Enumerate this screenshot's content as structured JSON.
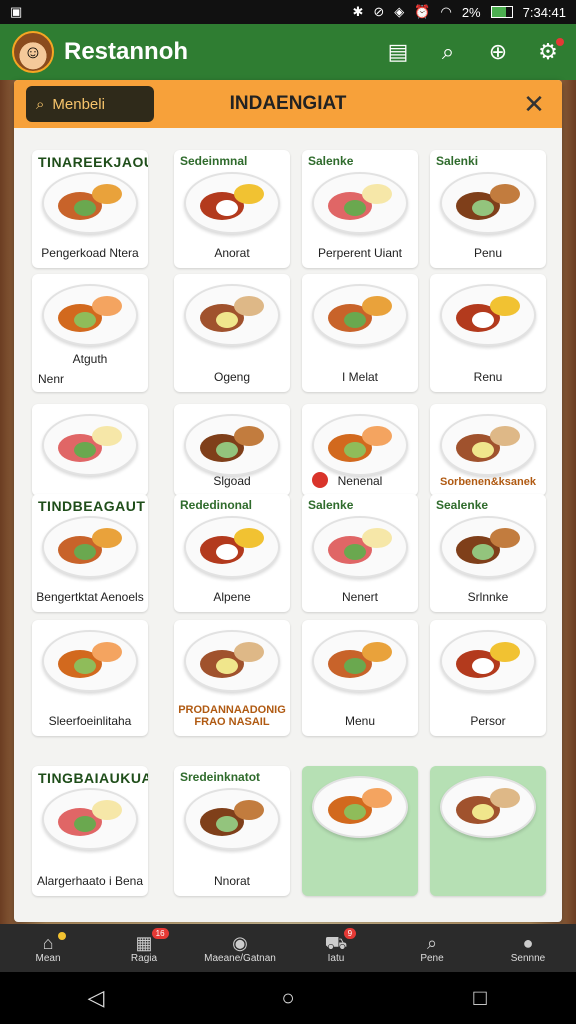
{
  "status": {
    "left_icon": "notification-icon",
    "battery": "2%",
    "time": "7:34:41"
  },
  "app": {
    "title": "Restannoh"
  },
  "panel": {
    "search_label": "Menbeli",
    "title": "INDAENGIAT"
  },
  "cells": [
    {
      "head": "TINAREEKJAOUT",
      "head_big": true,
      "label": "Pengerkoad Ntera",
      "extra": ""
    },
    {
      "head": "Sedeinmnal",
      "label": "Anorat"
    },
    {
      "head": "Salenke",
      "label": "Perperent Uiant"
    },
    {
      "head": "Salenki",
      "label": "Penu"
    },
    {
      "head": "",
      "label": "Atguth",
      "extra": "Nenr"
    },
    {
      "head": "",
      "label": "Ogeng"
    },
    {
      "head": "",
      "label": "I Melat"
    },
    {
      "head": "",
      "label": "Renu"
    },
    {
      "head": "",
      "label": ""
    },
    {
      "head": "",
      "label": "Slgoad"
    },
    {
      "head": "",
      "label": "Nenenal"
    },
    {
      "head": "",
      "label": "Sorbenen&ksanek"
    },
    {
      "head": "TINDBEAGAUT",
      "head_big": true,
      "label": "Bengertktat Aenoels"
    },
    {
      "head": "Rededinonal",
      "label": "Alpene"
    },
    {
      "head": "Salenke",
      "label": "Nenert"
    },
    {
      "head": "Sealenke",
      "label": "Srlnnke"
    },
    {
      "head": "",
      "label": "Sleerfoeinlitaha"
    },
    {
      "head": "",
      "label": "PRODANNAADONIG FRAO NASAIL"
    },
    {
      "head": "",
      "label": "Menu"
    },
    {
      "head": "",
      "label": "Persor"
    },
    {
      "head": "TINGBAIAUKUA",
      "head_big": true,
      "label": "Alargerhaato i Bena"
    },
    {
      "head": "Sredeinknatot",
      "label": "Nnorat"
    },
    {
      "head": "",
      "label": ""
    },
    {
      "head": "",
      "label": ""
    }
  ],
  "bottom_nav": [
    {
      "label": "Mean",
      "icon": "home-icon"
    },
    {
      "label": "Ragia",
      "icon": "store-icon",
      "badge": "16"
    },
    {
      "label": "Maeane/Gatnan",
      "icon": "camera-icon"
    },
    {
      "label": "Iatu",
      "icon": "cart-icon",
      "badge": "9"
    },
    {
      "label": "Pene",
      "icon": "search-icon"
    },
    {
      "label": "Sennne",
      "icon": "profile-icon"
    }
  ]
}
